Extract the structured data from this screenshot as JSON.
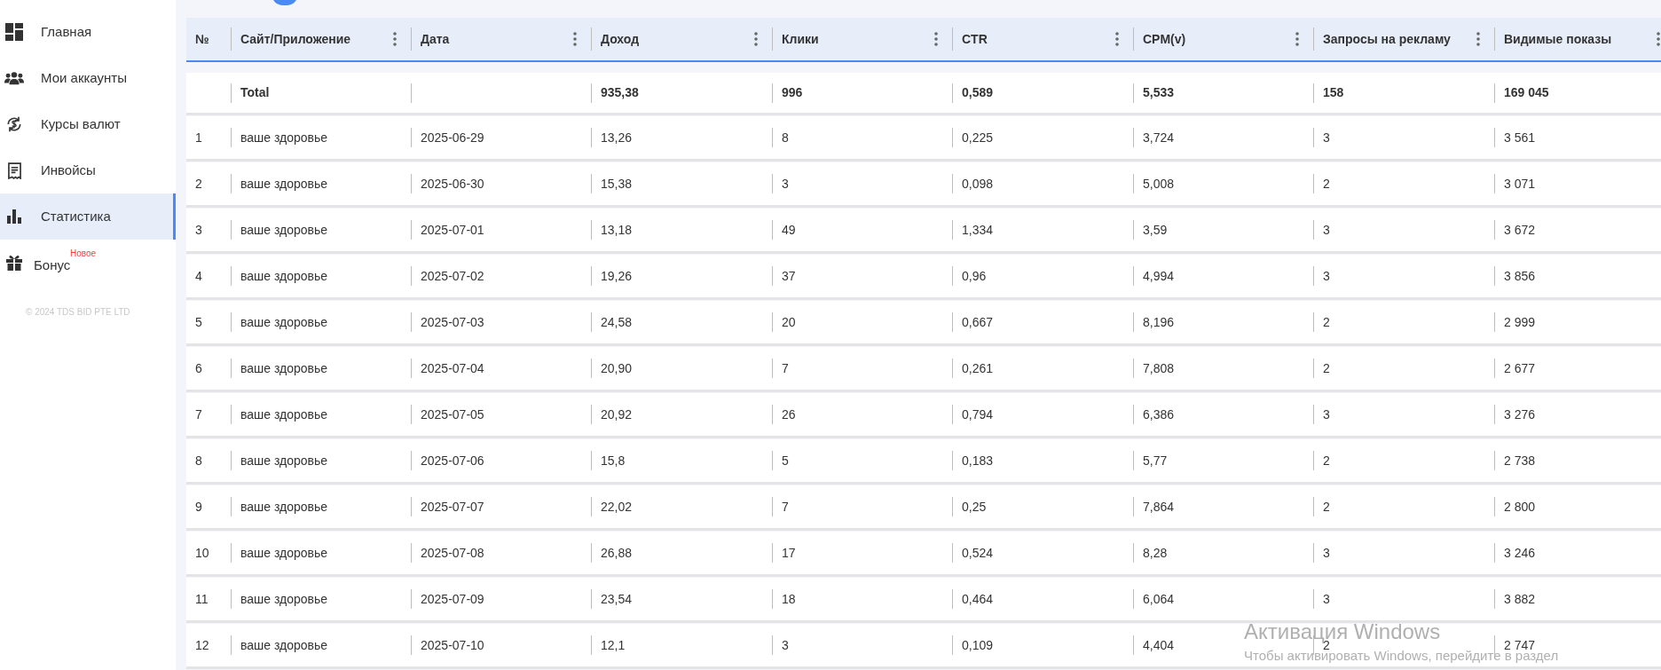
{
  "sidebar": {
    "items": [
      {
        "label": "Главная",
        "selected": false
      },
      {
        "label": "Мои аккаунты",
        "selected": false
      },
      {
        "label": "Курсы валют",
        "selected": false
      },
      {
        "label": "Инвойсы",
        "selected": false
      },
      {
        "label": "Статистика",
        "selected": true
      },
      {
        "label": "Бонус",
        "selected": false,
        "badge": "Новое"
      }
    ],
    "footer": "© 2024 TDS BID PTE LTD"
  },
  "table": {
    "columns": [
      "№",
      "Сайт/Приложение",
      "Дата",
      "Доход",
      "Клики",
      "CTR",
      "CPM(v)",
      "Запросы на рекламу",
      "Видимые показы"
    ],
    "total": {
      "label": "Total",
      "values": [
        "935,38",
        "996",
        "0,589",
        "5,533",
        "158",
        "169 045"
      ]
    },
    "rows": [
      [
        "1",
        "ваше здоровье",
        "2025-06-29",
        "13,26",
        "8",
        "0,225",
        "3,724",
        "3",
        "3 561"
      ],
      [
        "2",
        "ваше здоровье",
        "2025-06-30",
        "15,38",
        "3",
        "0,098",
        "5,008",
        "2",
        "3 071"
      ],
      [
        "3",
        "ваше здоровье",
        "2025-07-01",
        "13,18",
        "49",
        "1,334",
        "3,59",
        "3",
        "3 672"
      ],
      [
        "4",
        "ваше здоровье",
        "2025-07-02",
        "19,26",
        "37",
        "0,96",
        "4,994",
        "3",
        "3 856"
      ],
      [
        "5",
        "ваше здоровье",
        "2025-07-03",
        "24,58",
        "20",
        "0,667",
        "8,196",
        "2",
        "2 999"
      ],
      [
        "6",
        "ваше здоровье",
        "2025-07-04",
        "20,90",
        "7",
        "0,261",
        "7,808",
        "2",
        "2 677"
      ],
      [
        "7",
        "ваше здоровье",
        "2025-07-05",
        "20,92",
        "26",
        "0,794",
        "6,386",
        "3",
        "3 276"
      ],
      [
        "8",
        "ваше здоровье",
        "2025-07-06",
        "15,8",
        "5",
        "0,183",
        "5,77",
        "2",
        "2 738"
      ],
      [
        "9",
        "ваше здоровье",
        "2025-07-07",
        "22,02",
        "7",
        "0,25",
        "7,864",
        "2",
        "2 800"
      ],
      [
        "10",
        "ваше здоровье",
        "2025-07-08",
        "26,88",
        "17",
        "0,524",
        "8,28",
        "3",
        "3 246"
      ],
      [
        "11",
        "ваше здоровье",
        "2025-07-09",
        "23,54",
        "18",
        "0,464",
        "6,064",
        "3",
        "3 882"
      ],
      [
        "12",
        "ваше здоровье",
        "2025-07-10",
        "12,1",
        "3",
        "0,109",
        "4,404",
        "2",
        "2 747"
      ]
    ]
  },
  "os_overlay": {
    "title": "Активация Windows",
    "text": "Чтобы активировать Windows, перейдите в раздел"
  }
}
